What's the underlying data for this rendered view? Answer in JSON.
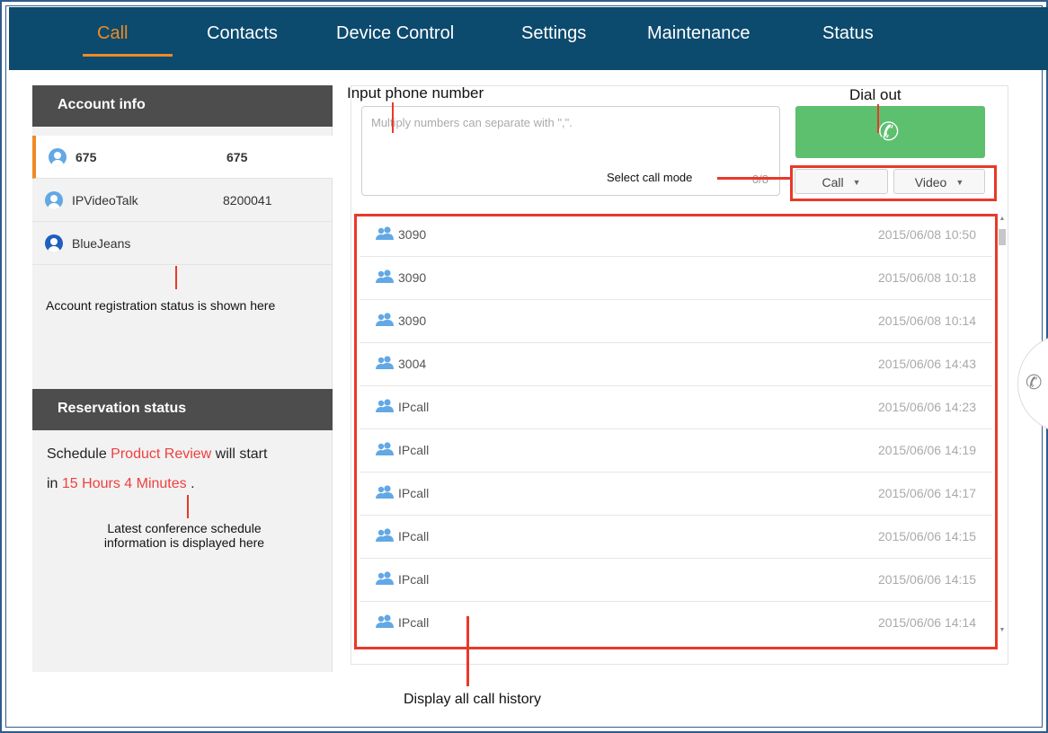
{
  "nav": {
    "items": [
      "Call",
      "Contacts",
      "Device Control",
      "Settings",
      "Maintenance",
      "Status"
    ],
    "active": "Call",
    "accent": "#f08a24",
    "background": "#0c4a6e"
  },
  "account_info": {
    "title": "Account info",
    "accounts": [
      {
        "name": "675",
        "number": "675",
        "active": true
      },
      {
        "name": "IPVideoTalk",
        "number": "8200041",
        "active": false
      },
      {
        "name": "BlueJeans",
        "number": "",
        "active": false
      }
    ]
  },
  "reservation": {
    "title": "Reservation status",
    "line1_prefix": "Schedule ",
    "schedule_name": "Product Review",
    "line1_suffix": " will start",
    "line2_prefix": "in ",
    "time_left": "15 Hours 4 Minutes",
    "line2_suffix": " ."
  },
  "dialer": {
    "placeholder": "Multiply numbers can separate with \",\".",
    "char_count": "0/8",
    "call_mode": "Call",
    "media_mode": "Video"
  },
  "call_history": [
    {
      "name": "3090",
      "time": "2015/06/08 10:50"
    },
    {
      "name": "3090",
      "time": "2015/06/08 10:18"
    },
    {
      "name": "3090",
      "time": "2015/06/08 10:14"
    },
    {
      "name": "3004",
      "time": "2015/06/06 14:43"
    },
    {
      "name": "IPcall",
      "time": "2015/06/06 14:23"
    },
    {
      "name": "IPcall",
      "time": "2015/06/06 14:19"
    },
    {
      "name": "IPcall",
      "time": "2015/06/06 14:17"
    },
    {
      "name": "IPcall",
      "time": "2015/06/06 14:15"
    },
    {
      "name": "IPcall",
      "time": "2015/06/06 14:15"
    },
    {
      "name": "IPcall",
      "time": "2015/06/06 14:14"
    }
  ],
  "annotations": {
    "input_phone_number": "Input phone number",
    "dial_out": "Dial out",
    "select_call_mode": "Select call mode",
    "account_status": "Account registration status is shown here",
    "schedule_info": "Latest conference schedule information is displayed here",
    "call_history": "Display all call history",
    "color": "#e8392a"
  },
  "icons": {
    "account": "user-icon",
    "dial": "phone-icon",
    "history_entry": "group-icon",
    "side": "phone-icon"
  }
}
